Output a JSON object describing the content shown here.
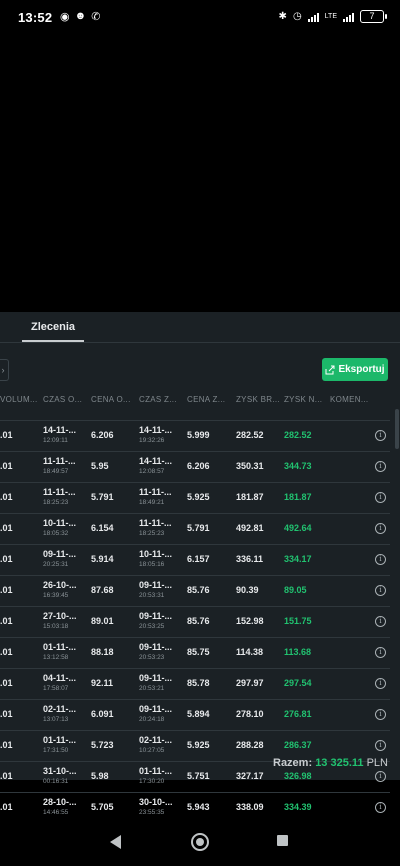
{
  "status_bar": {
    "time": "13:52",
    "network": "LTE",
    "battery": "7"
  },
  "tabs": {
    "active": "Zlecenia"
  },
  "toolbar": {
    "export_label": "Eksportuj"
  },
  "table": {
    "headers": [
      "VOLUM...",
      "CZAS O...",
      "CENA O...",
      "CZAS Z...",
      "CENA Z...",
      "ZYSK BR...",
      "ZYSK N...",
      "KOMEN..."
    ],
    "rows": [
      {
        "vol": ".01",
        "open_date": "14-11-...",
        "open_time": "12:09:11",
        "open_price": "6.206",
        "close_date": "14-11-...",
        "close_time": "19:32:26",
        "close_price": "5.999",
        "gross": "282.52",
        "net": "282.52"
      },
      {
        "vol": ".01",
        "open_date": "11-11-...",
        "open_time": "18:49:57",
        "open_price": "5.95",
        "close_date": "14-11-...",
        "close_time": "12:08:57",
        "close_price": "6.206",
        "gross": "350.31",
        "net": "344.73"
      },
      {
        "vol": ".01",
        "open_date": "11-11-...",
        "open_time": "18:25:23",
        "open_price": "5.791",
        "close_date": "11-11-...",
        "close_time": "18:49:21",
        "close_price": "5.925",
        "gross": "181.87",
        "net": "181.87"
      },
      {
        "vol": ".01",
        "open_date": "10-11-...",
        "open_time": "18:05:32",
        "open_price": "6.154",
        "close_date": "11-11-...",
        "close_time": "18:25:23",
        "close_price": "5.791",
        "gross": "492.81",
        "net": "492.64"
      },
      {
        "vol": ".01",
        "open_date": "09-11-...",
        "open_time": "20:25:31",
        "open_price": "5.914",
        "close_date": "10-11-...",
        "close_time": "18:05:16",
        "close_price": "6.157",
        "gross": "336.11",
        "net": "334.17"
      },
      {
        "vol": ".01",
        "open_date": "26-10-...",
        "open_time": "16:39:45",
        "open_price": "87.68",
        "close_date": "09-11-...",
        "close_time": "20:53:31",
        "close_price": "85.76",
        "gross": "90.39",
        "net": "89.05"
      },
      {
        "vol": ".01",
        "open_date": "27-10-...",
        "open_time": "15:03:18",
        "open_price": "89.01",
        "close_date": "09-11-...",
        "close_time": "20:53:25",
        "close_price": "85.76",
        "gross": "152.98",
        "net": "151.75"
      },
      {
        "vol": ".01",
        "open_date": "01-11-...",
        "open_time": "13:12:58",
        "open_price": "88.18",
        "close_date": "09-11-...",
        "close_time": "20:53:23",
        "close_price": "85.75",
        "gross": "114.38",
        "net": "113.68"
      },
      {
        "vol": ".01",
        "open_date": "04-11-...",
        "open_time": "17:58:07",
        "open_price": "92.11",
        "close_date": "09-11-...",
        "close_time": "20:53:21",
        "close_price": "85.78",
        "gross": "297.97",
        "net": "297.54"
      },
      {
        "vol": ".01",
        "open_date": "02-11-...",
        "open_time": "13:07:13",
        "open_price": "6.091",
        "close_date": "09-11-...",
        "close_time": "20:24:18",
        "close_price": "5.894",
        "gross": "278.10",
        "net": "276.81"
      },
      {
        "vol": ".01",
        "open_date": "01-11-...",
        "open_time": "17:31:50",
        "open_price": "5.723",
        "close_date": "02-11-...",
        "close_time": "10:27:05",
        "close_price": "5.925",
        "gross": "288.28",
        "net": "286.37"
      },
      {
        "vol": ".01",
        "open_date": "31-10-...",
        "open_time": "00:16:31",
        "open_price": "5.98",
        "close_date": "01-11-...",
        "close_time": "17:30:20",
        "close_price": "5.751",
        "gross": "327.17",
        "net": "326.98"
      },
      {
        "vol": ".01",
        "open_date": "28-10-...",
        "open_time": "14:46:55",
        "open_price": "5.705",
        "close_date": "30-10-...",
        "close_time": "23:55:35",
        "close_price": "5.943",
        "gross": "338.09",
        "net": "334.39"
      }
    ]
  },
  "summary": {
    "label": "Razem:",
    "amount": "13 325.11",
    "currency": "PLN"
  },
  "colors": {
    "accent": "#1cb86a",
    "positive": "#21c270",
    "panel": "#1b2125"
  },
  "icons": {
    "row_action": "info-icon",
    "export": "share-icon"
  }
}
